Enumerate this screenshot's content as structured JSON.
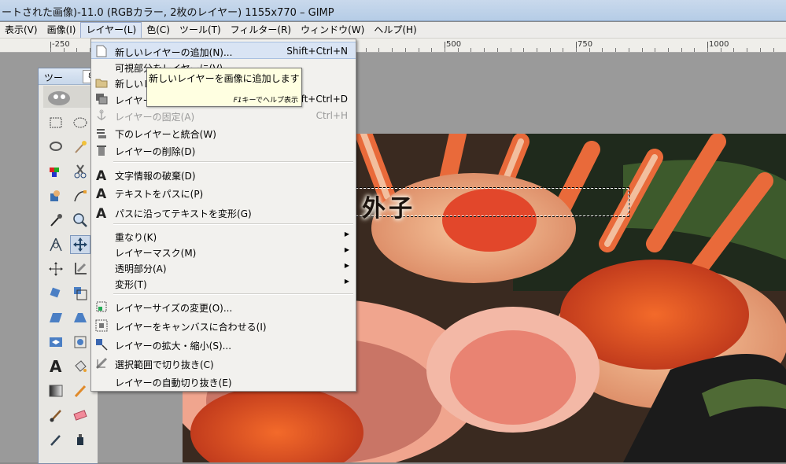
{
  "window": {
    "title": "ートされた画像)-11.0 (RGBカラー, 2枚のレイヤー) 1155x770 – GIMP"
  },
  "menubar": {
    "items": [
      {
        "label": "表示(V)"
      },
      {
        "label": "画像(I)"
      },
      {
        "label": "レイヤー(L)"
      },
      {
        "label": "色(C)"
      },
      {
        "label": "ツール(T)"
      },
      {
        "label": "フィルター(R)"
      },
      {
        "label": "ウィンドウ(W)"
      },
      {
        "label": "ヘルプ(H)"
      }
    ]
  },
  "ruler": {
    "labels": [
      "-250",
      "500",
      "750",
      "1000"
    ]
  },
  "toolbox": {
    "title": "ツー",
    "search_glyph": "8"
  },
  "layer_menu": {
    "items": [
      {
        "label": "新しいレイヤーの追加(N)...",
        "shortcut": "Shift+Ctrl+N",
        "icon": "new-layer-icon",
        "highlighted": true
      },
      {
        "label": "可視部分をレイヤーに(V)",
        "shortcut": "",
        "icon": ""
      },
      {
        "label": "新しいレ",
        "shortcut": "",
        "icon": "folder-icon"
      },
      {
        "label": "レイヤー",
        "shortcut": "Shift+Ctrl+D",
        "icon": "duplicate-layer-icon"
      },
      {
        "label": "レイヤーの固定(A)",
        "shortcut": "Ctrl+H",
        "icon": "anchor-icon",
        "disabled": true
      },
      {
        "label": "下のレイヤーと統合(W)",
        "shortcut": "",
        "icon": "merge-down-icon"
      },
      {
        "label": "レイヤーの削除(D)",
        "shortcut": "",
        "icon": "delete-layer-icon"
      },
      {
        "label": "文字情報の破棄(D)",
        "shortcut": "",
        "icon": "text-tool-icon"
      },
      {
        "label": "テキストをパスに(P)",
        "shortcut": "",
        "icon": "text-tool-icon"
      },
      {
        "label": "パスに沿ってテキストを変形(G)",
        "shortcut": "",
        "icon": "text-tool-icon"
      },
      {
        "label": "重なり(K)",
        "submenu": true
      },
      {
        "label": "レイヤーマスク(M)",
        "submenu": true
      },
      {
        "label": "透明部分(A)",
        "submenu": true
      },
      {
        "label": "変形(T)",
        "submenu": true
      },
      {
        "label": "レイヤーサイズの変更(O)...",
        "icon": "layer-size-icon"
      },
      {
        "label": "レイヤーをキャンバスに合わせる(I)",
        "icon": "layer-to-canvas-icon"
      },
      {
        "label": "レイヤーの拡大・縮小(S)...",
        "icon": "scale-layer-icon"
      },
      {
        "label": "選択範囲で切り抜き(C)",
        "icon": "crop-icon"
      },
      {
        "label": "レイヤーの自動切り抜き(E)",
        "icon": ""
      }
    ]
  },
  "tooltip": {
    "text": "新しいレイヤーを画像に追加します",
    "help_key": "F1",
    "help_text": "キーでヘルプ表示"
  },
  "canvas": {
    "caption_text": "セコガニ内子・外子"
  },
  "colors": {
    "menu_highlight": "#d9e4f4",
    "tooltip_bg": "#ffffe1",
    "titlebar": "#b5cce6"
  }
}
